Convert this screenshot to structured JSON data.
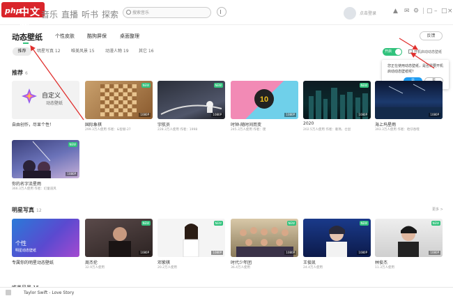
{
  "titlebar": {
    "logo_php": "php",
    "logo_cn": "中文网",
    "tabs": [
      "音乐",
      "直播",
      "听书",
      "探索"
    ],
    "search_placeholder": "搜索音乐",
    "login_text": "点击登录",
    "window_icons": [
      "shirt-icon",
      "mail-icon",
      "settings-icon",
      "mini-player-icon",
      "minimize-icon",
      "maximize-icon",
      "close-icon"
    ]
  },
  "header": {
    "title": "动态壁纸",
    "tabs": [
      "个性皮肤",
      "酷狗屏保",
      "桌面整理"
    ],
    "feedback": "反馈"
  },
  "filters": [
    {
      "label": "推荐",
      "active": true
    },
    {
      "label": "明星写真 12"
    },
    {
      "label": "唯美风景 15"
    },
    {
      "label": "动漫人物 19"
    },
    {
      "label": "其它 16"
    }
  ],
  "toggle": {
    "label": "开启",
    "on": true
  },
  "autostart": {
    "label": "开机启动动态壁纸"
  },
  "popup": {
    "text": "您正在使用动态壁纸，是否需要开机启动动态壁纸呢？",
    "yes": "是",
    "no": "否"
  },
  "sections": {
    "recommend": {
      "title": "推荐",
      "count": "6"
    },
    "stars": {
      "title": "明星写真",
      "count": "12",
      "more": "更多 >"
    },
    "scenery": {
      "title": "唯美风景",
      "count": "15"
    }
  },
  "recommend_cards": [
    {
      "title": "自定义",
      "subtitle": "动态壁纸",
      "name": "自由创作，尽显个性！",
      "stat": ""
    },
    {
      "name": "国际象棋",
      "stat": "299.3万人使用  作者：&智赫-27",
      "badge": "NEW",
      "res": "1080P"
    },
    {
      "name": "宇航员",
      "stat": "228.3万人使用  作者：1998",
      "badge": "NEW",
      "res": "1080P"
    },
    {
      "name": "时钟-随时间而变",
      "stat": "245.3万人使用  作者：璞",
      "badge": "",
      "res": "1080P"
    },
    {
      "name": "2020",
      "stat": "202.5万人使用  作者：奢瑪、仓鼠",
      "badge": "NEW",
      "res": "1080P"
    },
    {
      "name": "海上坞星雨",
      "stat": "393.3万人使用  作者：哈仔吞噬",
      "badge": "",
      "res": "1080P"
    },
    {
      "name": "你的名字流星雨",
      "stat": "366.3万人使用  作者：幻童道风",
      "badge": "NEW",
      "res": "1080P"
    }
  ],
  "star_cards": [
    {
      "name": "专属你的明星动态壁纸",
      "stat": "",
      "overlay": "个性",
      "overlay_sub": "明星动态壁纸"
    },
    {
      "name": "周杰伦",
      "stat": "32.9万人使用",
      "badge": "NEW",
      "res": "1080P"
    },
    {
      "name": "邓紫棋",
      "stat": "20.2万人使用",
      "badge": "NEW",
      "res": "1080P"
    },
    {
      "name": "时代少年团",
      "stat": "36.4万人使用",
      "badge": "NEW",
      "res": "1080P"
    },
    {
      "name": "王俊凯",
      "stat": "24.4万人使用",
      "badge": "NEW",
      "res": "1080P"
    },
    {
      "name": "林俊杰",
      "stat": "11.3万人使用",
      "badge": "NEW",
      "res": "1080P"
    }
  ],
  "player": {
    "now_playing": "Taylor Swift - Love Story"
  },
  "colors": {
    "accent": "#31c27c",
    "brand": "#d9252b",
    "annotation": "#e0302e",
    "blue": "#1e9bf0"
  }
}
